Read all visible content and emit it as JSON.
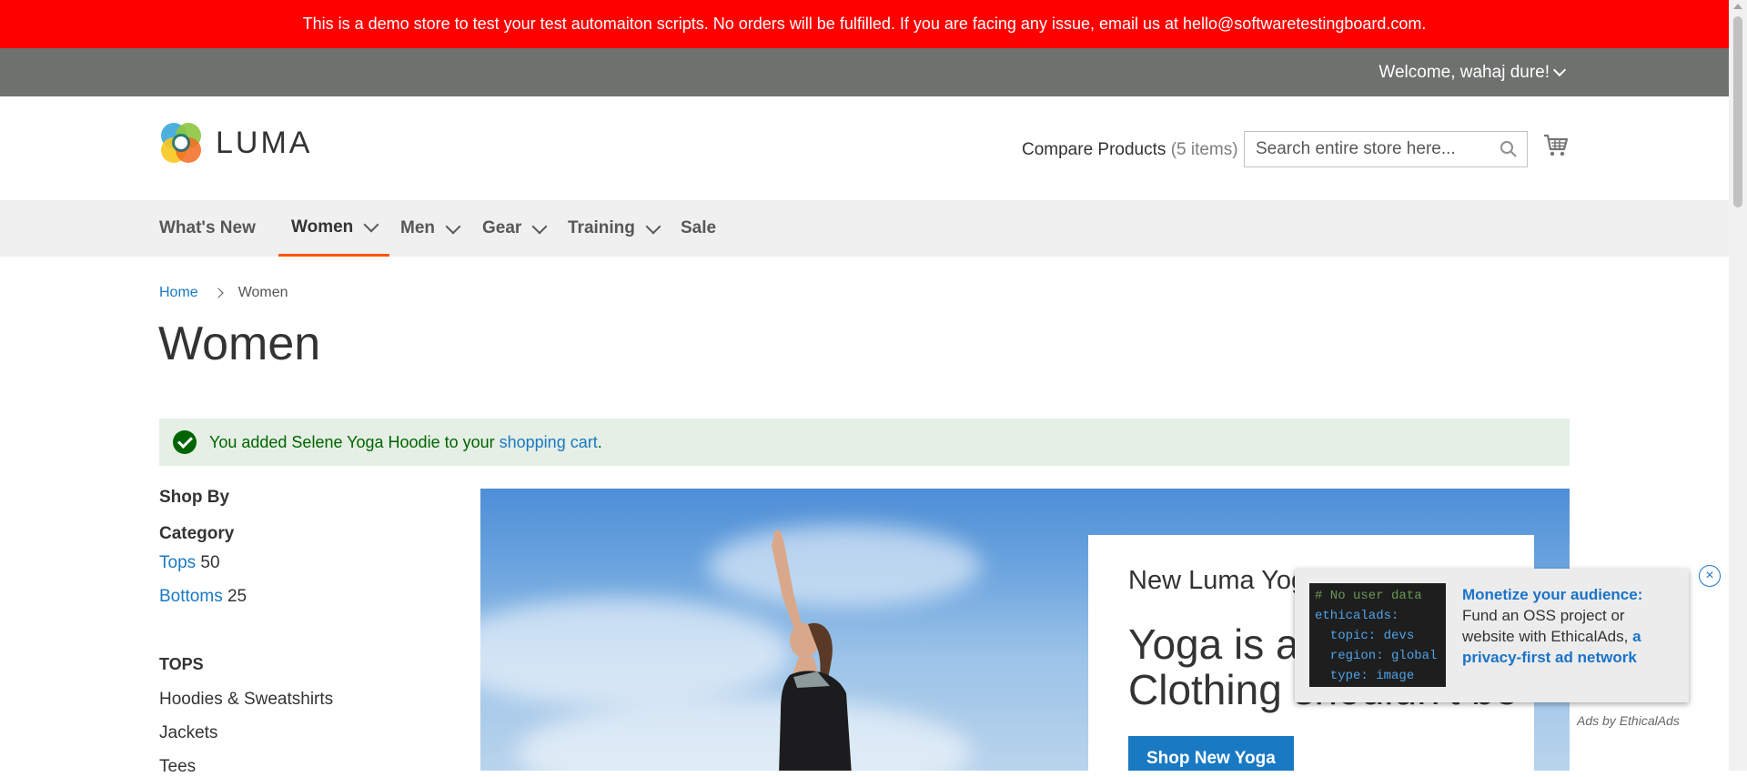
{
  "demo_notice": "This is a demo store to test your test automaiton scripts. No orders will be fulfilled. If you are facing any issue, email us at hello@softwaretestingboard.com.",
  "top_panel": {
    "welcome": "Welcome, wahaj dure!"
  },
  "header": {
    "logo_text": "LUMA",
    "compare_label": "Compare Products",
    "compare_count": "(5 items)",
    "search_placeholder": "Search entire store here..."
  },
  "nav": [
    {
      "label": "What's New"
    },
    {
      "label": "Women"
    },
    {
      "label": "Men"
    },
    {
      "label": "Gear"
    },
    {
      "label": "Training"
    },
    {
      "label": "Sale"
    }
  ],
  "breadcrumb": {
    "home": "Home",
    "current": "Women"
  },
  "page_title": "Women",
  "message": {
    "prefix": "You added Selene Yoga Hoodie to your",
    "link": "shopping cart",
    "suffix": "."
  },
  "sidebar": {
    "shop_by": "Shop By",
    "category_title": "Category",
    "categories": [
      {
        "label": "Tops",
        "count": "50"
      },
      {
        "label": "Bottoms",
        "count": "25"
      }
    ],
    "tops_title": "TOPS",
    "tops_links": [
      "Hoodies & Sweatshirts",
      "Jackets",
      "Tees"
    ]
  },
  "hero": {
    "subtitle": "New Luma Yoga Collection",
    "title": "Yoga is ancient Clothing shouldn't be",
    "button": "Shop New Yoga"
  },
  "ad": {
    "code_lines": [
      "# No user data",
      "ethicalads:",
      "  topic: devs",
      "  region: global",
      "  type: image"
    ],
    "headline": "Monetize your audience:",
    "body": "Fund an OSS project or website with EthicalAds,",
    "link": "a privacy-first ad network",
    "attribution": "Ads by EthicalAds",
    "close": "×"
  },
  "colors": {
    "notice_bg": "#ff0000",
    "panel_bg": "#6e716e",
    "nav_active": "#ff5501",
    "link": "#1979c3",
    "success_bg": "#e5efe5",
    "success_text": "#006400"
  }
}
